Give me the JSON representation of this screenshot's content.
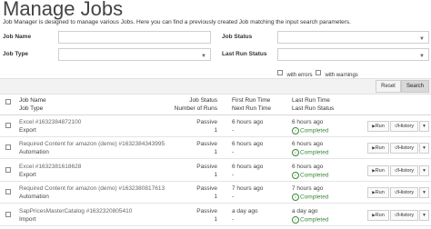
{
  "page": {
    "title": "Manage Jobs",
    "description": "Job Manager is designed to manage various Jobs. Here you can find a previously created Job matching the input search parameters."
  },
  "filters": {
    "job_name_label": "Job Name",
    "job_status_label": "Job Status",
    "job_type_label": "Job Type",
    "last_run_status_label": "Last Run Status",
    "with_errors_label": "with errors",
    "with_warnings_label": "with warnings"
  },
  "buttons": {
    "reset": "Reset",
    "search": "Search"
  },
  "table": {
    "headers": {
      "col1_line1": "Job Name",
      "col1_line2": "Job Type",
      "col2_line1": "Job Status",
      "col2_line2": "Number of Runs",
      "col3_line1": "First Run Time",
      "col3_line2": "Next Run Time",
      "col4_line1": "Last Run Time",
      "col4_line2": "Last Run Status"
    },
    "run_label": "Run",
    "history_label": "History",
    "rows": [
      {
        "name": "Excel #1632384872100",
        "type": "Export",
        "status": "Passive",
        "runs": "1",
        "first_run": "6 hours ago",
        "next_run": "-",
        "last_run": "6 hours ago",
        "last_status": "Completed"
      },
      {
        "name": "Required Content for amazon (demo) #1632384343995",
        "type": "Automation",
        "status": "Passive",
        "runs": "1",
        "first_run": "6 hours ago",
        "next_run": "-",
        "last_run": "6 hours ago",
        "last_status": "Completed"
      },
      {
        "name": "Excel #1632381618628",
        "type": "Export",
        "status": "Passive",
        "runs": "1",
        "first_run": "6 hours ago",
        "next_run": "-",
        "last_run": "6 hours ago",
        "last_status": "Completed"
      },
      {
        "name": "Required Content for amazon (demo) #1632380817613",
        "type": "Automation",
        "status": "Passive",
        "runs": "1",
        "first_run": "7 hours ago",
        "next_run": "-",
        "last_run": "7 hours ago",
        "last_status": "Completed"
      },
      {
        "name": "SapPricesMasterCatalog #1632320805410",
        "type": "Import",
        "status": "Passive",
        "runs": "1",
        "first_run": "a day ago",
        "next_run": "-",
        "last_run": "a day ago",
        "last_status": "Completed"
      }
    ]
  },
  "colors": {
    "completed": "#3a8a3a",
    "toolbar_bg": "#f2f2f2"
  }
}
